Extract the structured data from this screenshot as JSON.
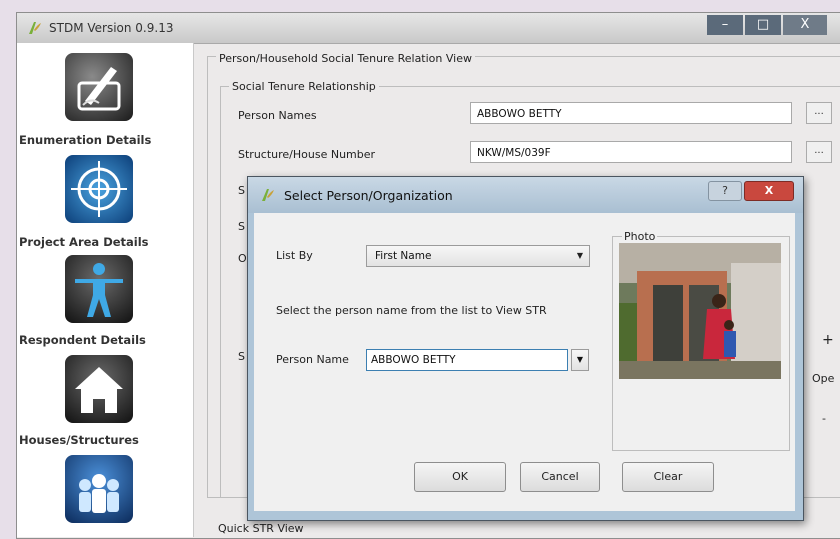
{
  "window": {
    "title": "STDM Version 0.9.13",
    "controls": [
      "–",
      "□",
      "X"
    ]
  },
  "sidebar": {
    "items": [
      {
        "label": "Enumeration Details",
        "icon": "pen-signature-icon"
      },
      {
        "label": "Project Area Details",
        "icon": "target-map-icon"
      },
      {
        "label": "Respondent Details",
        "icon": "person-icon"
      },
      {
        "label": "Houses/Structures",
        "icon": "house-icon"
      },
      {
        "label": "",
        "icon": "people-group-icon"
      }
    ]
  },
  "main": {
    "outer_legend": "Person/Household Social Tenure Relation View",
    "inner_legend": "Social Tenure Relationship",
    "person_names_label": "Person Names",
    "person_names_value": "ABBOWO BETTY",
    "structure_label": "Structure/House Number",
    "structure_value": "NKW/MS/039F",
    "ellipsis": "...",
    "stub_s1": "S",
    "stub_s2": "S",
    "stub_o": "O",
    "stub_s3": "S",
    "stub_plus": "+",
    "stub_ope": "Ope",
    "stub_dash": "-",
    "quick_legend": "Quick STR View"
  },
  "dialog": {
    "title": "Select Person/Organization",
    "help": "?",
    "close": "X",
    "list_by_label": "List By",
    "list_by_value": "First Name",
    "instruction": "Select the person name from the list  to View STR",
    "person_name_label": "Person Name",
    "person_name_value": "ABBOWO BETTY",
    "photo_legend": "Photo",
    "buttons": {
      "ok": "OK",
      "cancel": "Cancel",
      "clear": "Clear"
    }
  },
  "colors": {
    "page_bg": "#e7dfe9",
    "window_bg": "#eceaea",
    "dialog_frame": "#aec5d8",
    "close_red": "#c9483e",
    "focus_blue": "#3c7fb1"
  }
}
